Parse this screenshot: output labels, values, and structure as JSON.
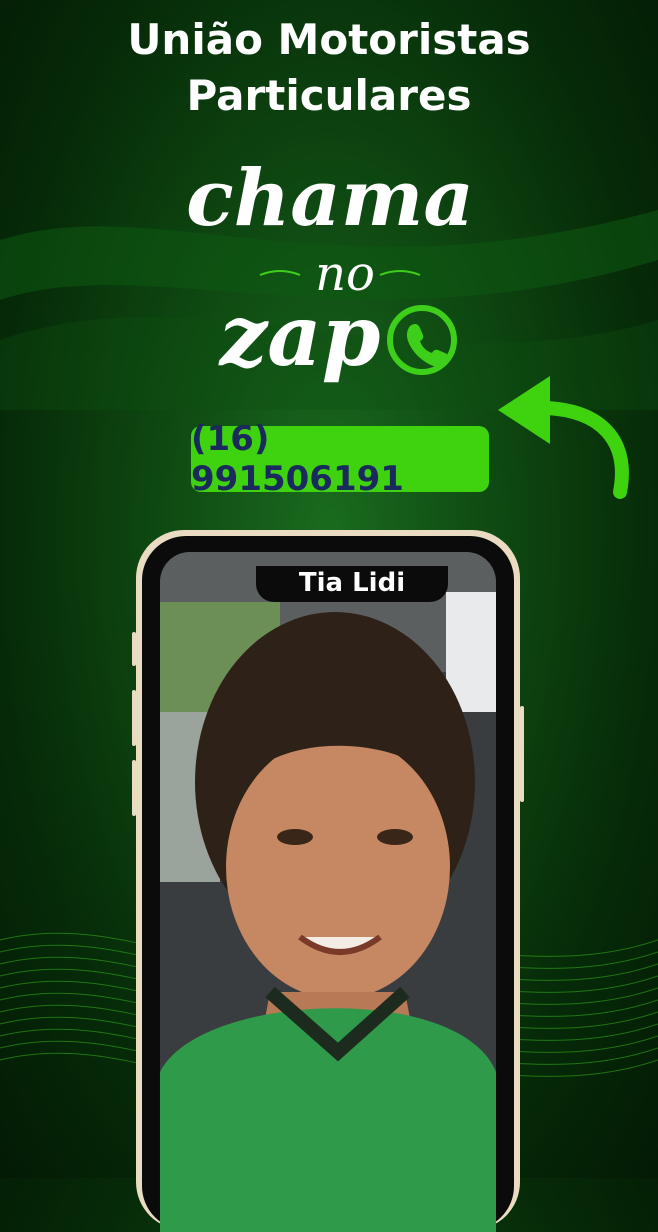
{
  "header": {
    "title_line1": "União Motoristas",
    "title_line2": "Particulares"
  },
  "promo": {
    "script_word1": "chama",
    "script_word2": "no",
    "script_word3": "zap",
    "icon": "whatsapp-icon"
  },
  "contact": {
    "phone": "(16) 991506191",
    "arrow_icon": "curved-arrow-icon"
  },
  "profile": {
    "name": "Tia Lidi"
  },
  "colors": {
    "badge_green": "#3fd30f",
    "badge_text": "#1b2a5c",
    "background_dark": "#062b08",
    "accent_green": "#3ecf1a"
  }
}
